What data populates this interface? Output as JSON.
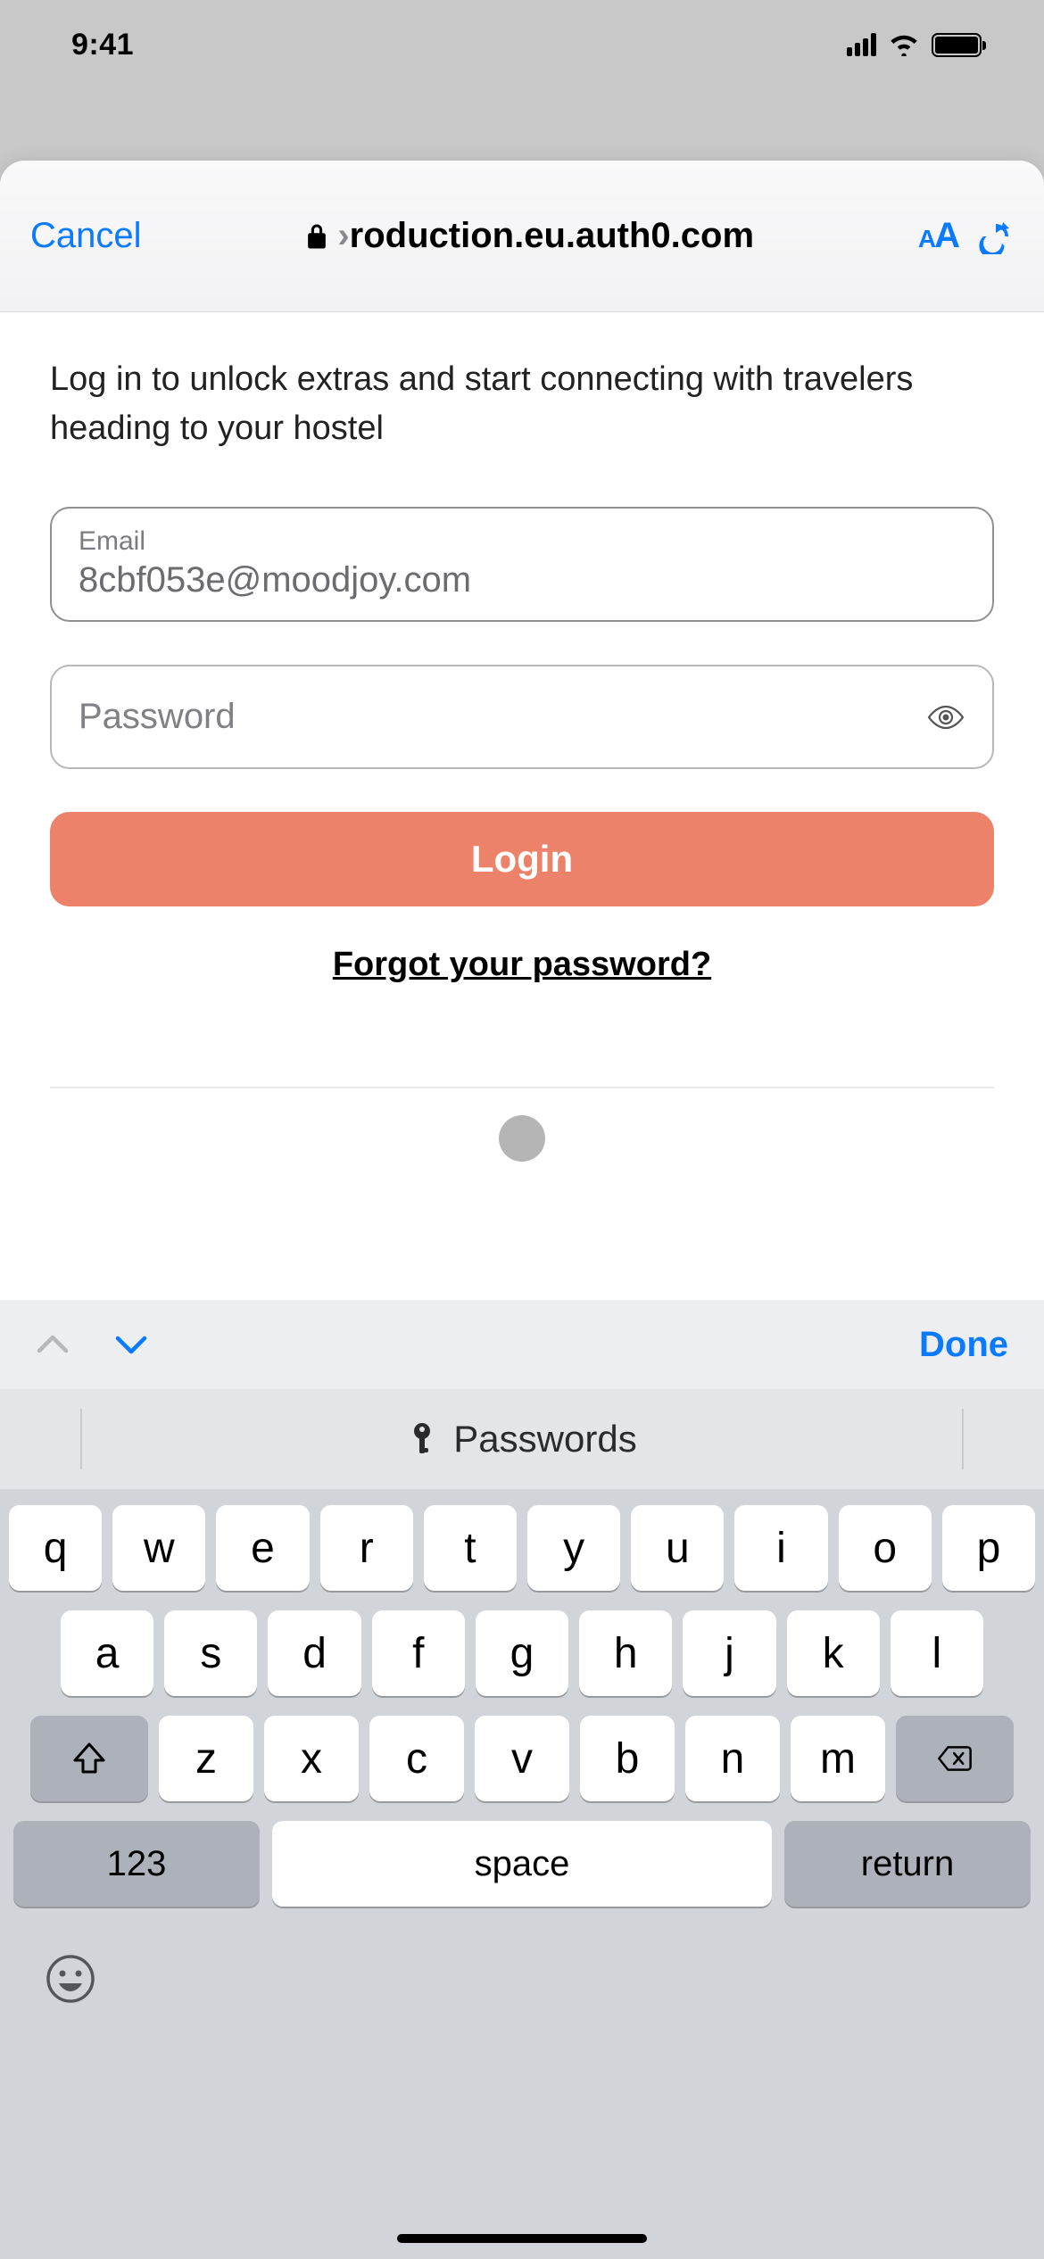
{
  "status": {
    "time": "9:41"
  },
  "nav": {
    "cancel": "Cancel",
    "url_fade": "›",
    "url": "roduction.eu.auth0.com",
    "aa_small": "A",
    "aa_big": "A"
  },
  "page": {
    "tagline": "Log in to unlock extras and start connecting with travelers heading to your hostel",
    "email_label": "Email",
    "email_value": "8cbf053e@moodjoy.com",
    "password_label": "Password",
    "login": "Login",
    "forgot": "Forgot your password?"
  },
  "keyboard": {
    "done": "Done",
    "suggestion": "Passwords",
    "row1": [
      "q",
      "w",
      "e",
      "r",
      "t",
      "y",
      "u",
      "i",
      "o",
      "p"
    ],
    "row2": [
      "a",
      "s",
      "d",
      "f",
      "g",
      "h",
      "j",
      "k",
      "l"
    ],
    "row3": [
      "z",
      "x",
      "c",
      "v",
      "b",
      "n",
      "m"
    ],
    "num": "123",
    "space": "space",
    "ret": "return"
  }
}
